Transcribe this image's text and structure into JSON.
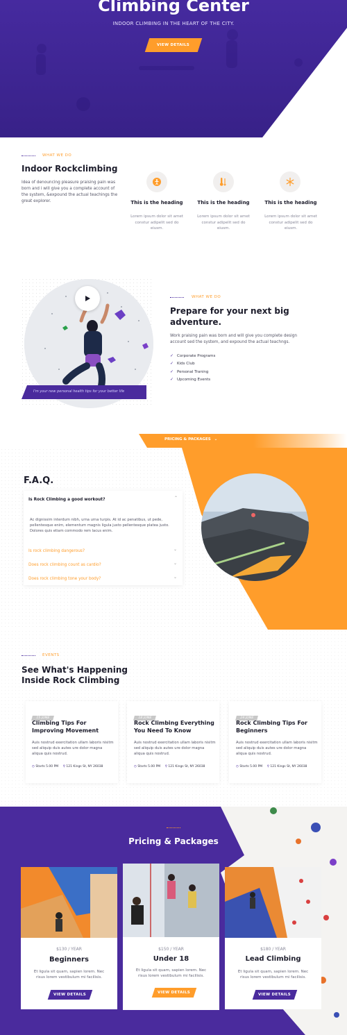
{
  "hero": {
    "title": "Climbing Center",
    "subtitle": "INDOOR CLIMBING IN THE HEART OF THE CITY.",
    "button": "VIEW DETAILS"
  },
  "what_we_do": {
    "eyebrow": "WHAT WE DO",
    "title": "Indoor Rockclimbing",
    "body": "Idea of denouncing pleasure praising pain was born and i will give you a complete account of the system, &expound the actual teachings the great explorer.",
    "features": [
      {
        "icon": "climber-icon",
        "heading": "This is the heading",
        "text": "Lorem ipsum dolor sit amet constur adipelit sed do eiusm."
      },
      {
        "icon": "thermometer-icon",
        "heading": "This is the heading",
        "text": "Lorem ipsum dolor sit amet constur adipelit sed do eiusm."
      },
      {
        "icon": "snowflake-icon",
        "heading": "This is the heading",
        "text": "Lorem ipsum dolor sit amet constur adipelit sed do eiusm."
      }
    ]
  },
  "adventure": {
    "caption": "I'm your new personal health tips for your better life",
    "eyebrow": "WHAT WE DO",
    "title": "Prepare for your next big adventure.",
    "body": "Work praising pain was born and will give you complete design account sed the system, and expound the actual teachngs.",
    "items": [
      "Corporate Programs",
      "Kids Club",
      "Personal Traning",
      "Upcoming Events"
    ]
  },
  "pricing_tab": {
    "label": "PRICING & PACKAGES"
  },
  "faq": {
    "title": "F.A.Q.",
    "open_question": "Is Rock Climbing a good workout?",
    "open_answer": "Ac dignissim interdum nibh, urna urna turpis. At id ac penatibus, ut pede, pellentesque enim, elementum magnis ligula justo pellentesque platea justo. Dolores quis etiam commodo rem lacus enim.",
    "questions": [
      "Is rock climbing dangerous?",
      "Does rock climbing count as cardio?",
      "Does rock climbing tone your body?"
    ]
  },
  "events": {
    "eyebrow": "EVENTS",
    "title_line1": "See What's Happening",
    "title_line2": "Inside Rock Climbing",
    "items": [
      {
        "date": "15 JUNE",
        "title": "Climbing Tips For Improving Movement",
        "text": "Auis nostrud exercitation ullam laboris nisitm sed aliquip duis autes ure dolor magna aliqua quis nostrud.",
        "time": "Starts 5.00 PM",
        "location": "121 Kings St, NY 26038"
      },
      {
        "date": "18 JUNE",
        "title": "Rock Climbing Everything You Need To Know",
        "text": "Auis nostrud exercitation ullam laboris nisitm sed aliquip duis autes ure dolor magna aliqua quis nostrud.",
        "time": "Starts 5.00 PM",
        "location": "121 Kings St, NY 26038"
      },
      {
        "date": "24 JUNE",
        "title": "Rock Climbing Tips For Beginners",
        "text": "Auis nostrud exercitation ullam laboris nisitm sed aliquip duis autes ure dolor magna aliqua quis nostrud.",
        "time": "Starts 5.00 PM",
        "location": "121 Kings St, NY 26038"
      }
    ]
  },
  "pricing": {
    "title": "Pricing & Packages",
    "packages": [
      {
        "price": "$130 / YEAR",
        "name": "Beginners",
        "desc": "Et ligula sit quam, sapien lorem. Nec risus lorem vestibulum mi facilisis.",
        "button": "VIEW DETAILS"
      },
      {
        "price": "$150 / YEAR",
        "name": "Under 18",
        "desc": "Et ligula sit quam, sapien lorem. Nec risus lorem vestibulum mi facilisis.",
        "button": "VIEW DETAILS"
      },
      {
        "price": "$180 / YEAR",
        "name": "Lead Climbing",
        "desc": "Et ligula sit quam, sapien lorem. Nec risus lorem vestibulum mi facilisis.",
        "button": "VIEW DETAILS"
      }
    ]
  },
  "colors": {
    "purple": "#4a2b9d",
    "orange": "#ff9d2b",
    "dark": "#1c1c2b"
  }
}
